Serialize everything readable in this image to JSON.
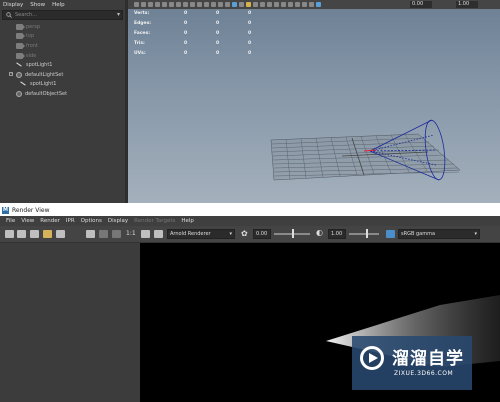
{
  "outliner": {
    "menu": [
      "Display",
      "Show",
      "Help"
    ],
    "search_placeholder": "Search...",
    "items": [
      {
        "label": "persp",
        "dim": true,
        "icon": "camera-icon"
      },
      {
        "label": "top",
        "dim": true,
        "icon": "camera-icon"
      },
      {
        "label": "front",
        "dim": true,
        "icon": "camera-icon"
      },
      {
        "label": "side",
        "dim": true,
        "icon": "camera-icon"
      },
      {
        "label": "spotLight1",
        "dim": false,
        "icon": "spotlight-icon"
      },
      {
        "label": "defaultLightSet",
        "dim": false,
        "icon": "set-icon"
      },
      {
        "label": "spotLight1",
        "dim": false,
        "icon": "spotlight-icon"
      },
      {
        "label": "defaultObjectSet",
        "dim": false,
        "icon": "set-icon"
      }
    ]
  },
  "viewport": {
    "exposure": "0.00",
    "gamma": "1.00",
    "hud": [
      {
        "label": "Verts:",
        "values": [
          "0",
          "0",
          "0"
        ]
      },
      {
        "label": "Edges:",
        "values": [
          "0",
          "0",
          "0"
        ]
      },
      {
        "label": "Faces:",
        "values": [
          "0",
          "0",
          "0"
        ]
      },
      {
        "label": "Tris:",
        "values": [
          "0",
          "0",
          "0"
        ]
      },
      {
        "label": "UVs:",
        "values": [
          "0",
          "0",
          "0"
        ]
      }
    ]
  },
  "render_view": {
    "title": "Render View",
    "menu": [
      "File",
      "View",
      "Render",
      "IPR",
      "Options",
      "Display",
      "Render Targets",
      "Help"
    ],
    "renderer": "Arnold Renderer",
    "ratio_label": "1:1",
    "exposure_value": "0.00",
    "gamma_value": "1.00",
    "color_space": "sRGB gamma"
  },
  "watermark": {
    "title": "溜溜自学",
    "subtitle": "ZIXUE.3D66.COM"
  },
  "colors": {
    "viewport_sky": "#7a8ca0",
    "cone": "#1a2a9a",
    "selection_blue": "#5aa0d8"
  }
}
